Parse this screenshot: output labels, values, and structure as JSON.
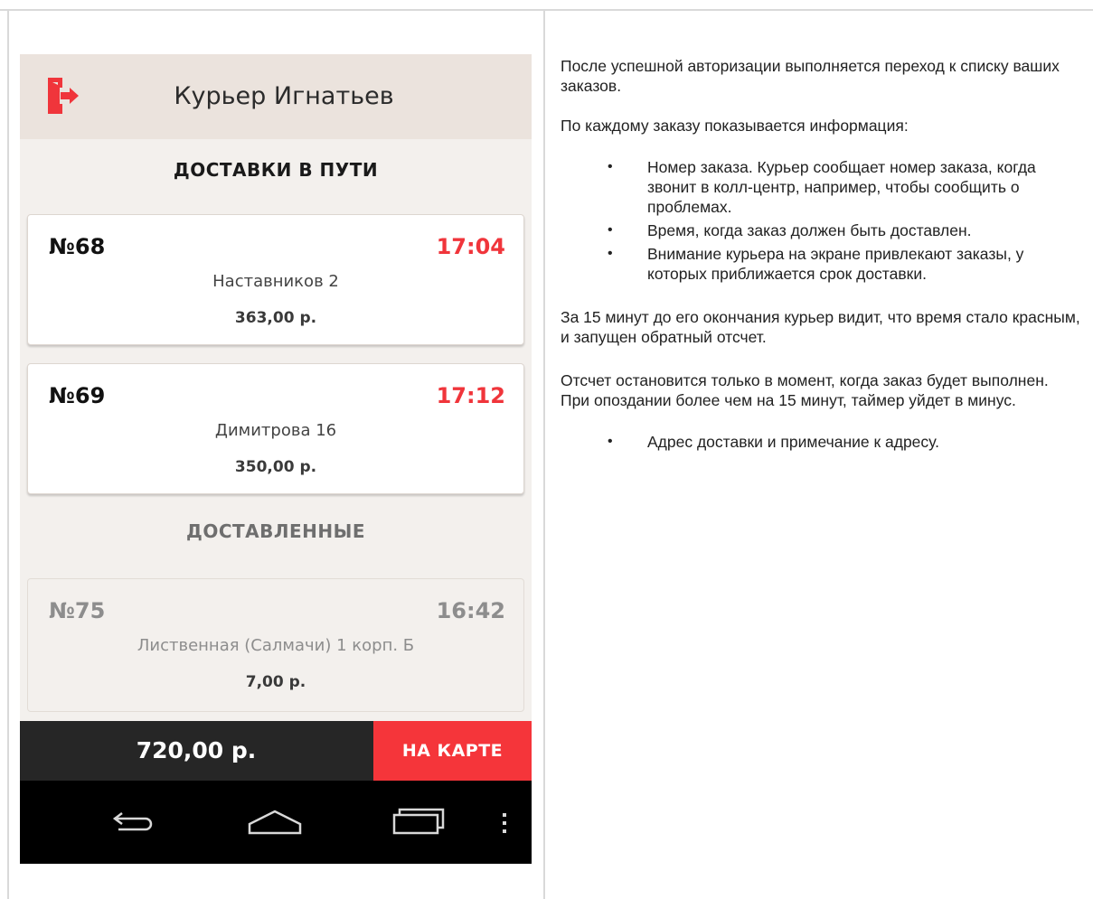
{
  "app": {
    "courier_name": "Курьер Игнатьев",
    "colors": {
      "accent": "#f5353a",
      "time_urgent": "#f0353b",
      "header_bg": "#ebe3dd",
      "screen_bg": "#f3f0ed"
    }
  },
  "sections": {
    "active_title": "ДОСТАВКИ В ПУТИ",
    "delivered_title": "ДОСТАВЛЕННЫЕ"
  },
  "active_orders": [
    {
      "number": "№68",
      "time": "17:04",
      "address": "Наставников 2",
      "sum": "363,00 р."
    },
    {
      "number": "№69",
      "time": "17:12",
      "address": "Димитрова 16",
      "sum": "350,00 р."
    }
  ],
  "delivered_orders": [
    {
      "number": "№75",
      "time": "16:42",
      "address": "Лиственная (Салмачи) 1 корп. Б",
      "sum": "7,00 р."
    }
  ],
  "bottom_bar": {
    "total": "720,00 р.",
    "map_button": "НА КАРТЕ"
  },
  "nav_icons": [
    "back-icon",
    "home-icon",
    "recent-apps-icon",
    "overflow-menu-icon"
  ],
  "description": {
    "p1": "После успешной авторизации выполняется переход к списку ваших заказов.",
    "p2": "По каждому заказу показывается информация:",
    "bullets": [
      "Номер заказа. Курьер сообщает номер заказа, когда звонит в колл-центр, например, чтобы сообщить о проблемах.",
      "Время, когда заказ должен быть доставлен.",
      "Внимание курьера на экране привлекают заказы, у которых приближается срок доставки."
    ],
    "p3": "За 15 минут до его окончания курьер видит, что время стало красным, и запущен обратный отсчет.",
    "p4": "Отсчет остановится только в момент, когда заказ будет выполнен. При опоздании более чем на 15 минут, таймер уйдет в минус.",
    "bullets2": [
      "Адрес доставки и примечание к адресу."
    ]
  }
}
